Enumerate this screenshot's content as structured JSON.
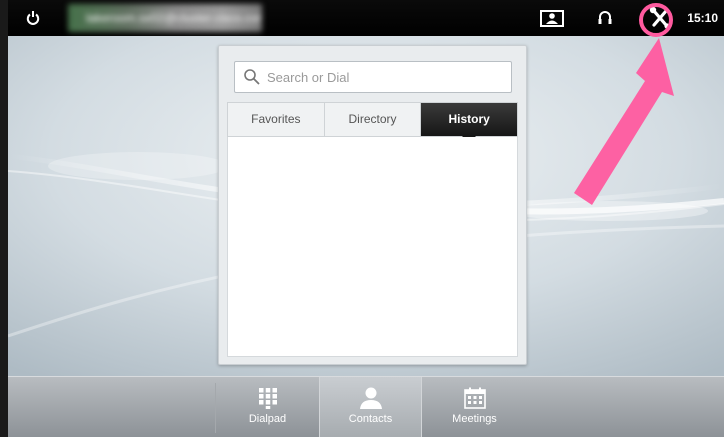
{
  "topbar": {
    "system_name": "lakeroom.sx02@cluster.cisco.com",
    "clock": "15:10"
  },
  "icons": {
    "power": "power-icon",
    "selfview": "selfview-icon",
    "headset": "headset-icon",
    "settings": "settings-wrench-icon",
    "search": "search-icon",
    "dialpad": "dialpad-icon",
    "contacts": "contacts-icon",
    "meetings": "meetings-icon"
  },
  "search": {
    "placeholder": "Search or Dial"
  },
  "tabs": [
    {
      "label": "Favorites",
      "active": false
    },
    {
      "label": "Directory",
      "active": false
    },
    {
      "label": "History",
      "active": true
    }
  ],
  "bottombar": {
    "dialpad_label": "Dialpad",
    "contacts_label": "Contacts",
    "meetings_label": "Meetings"
  },
  "colors": {
    "annotation": "#ff5a9f",
    "active_tab": "#1e1e1e",
    "topbar": "#000000"
  }
}
